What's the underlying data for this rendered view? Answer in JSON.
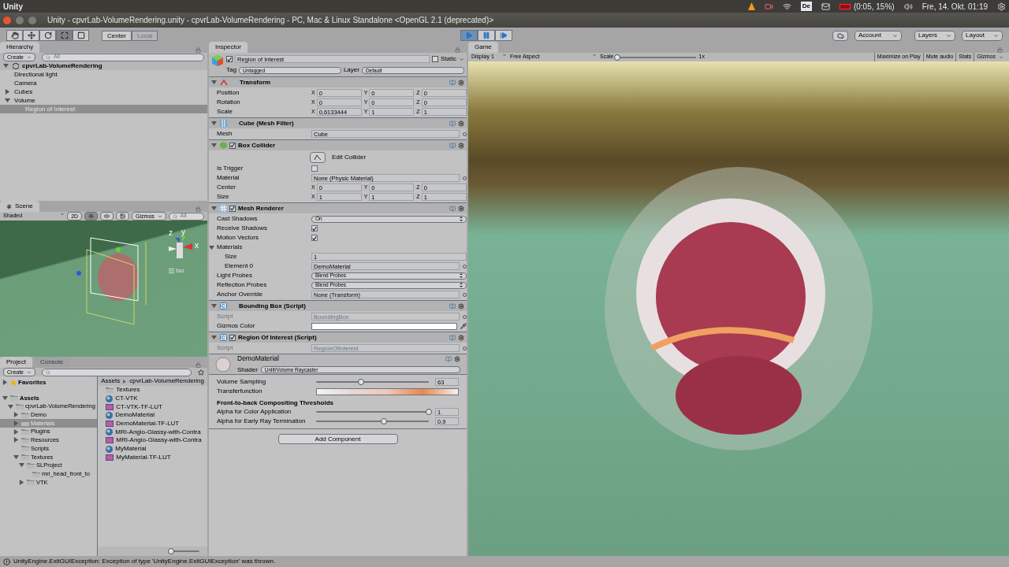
{
  "top_bar": {
    "app": "Unity",
    "keyboard": "De",
    "battery": "(0:05, 15%)",
    "clock": "Fre, 14. Okt. 01:19"
  },
  "window": {
    "title": "Unity - cpvrLab-VolumeRendering.unity - cpvrLab-VolumeRendering - PC, Mac & Linux Standalone <OpenGL 2.1 (deprecated)>"
  },
  "toolbar": {
    "tools": [
      {
        "kind": "hand",
        "selected": false
      },
      {
        "kind": "move",
        "selected": false
      },
      {
        "kind": "rotate",
        "selected": false
      },
      {
        "kind": "scale",
        "selected": true
      },
      {
        "kind": "rect",
        "selected": false
      }
    ],
    "pivot": [
      {
        "label": "Center",
        "selected": true
      },
      {
        "label": "Local",
        "selected": false
      }
    ],
    "playback": [
      {
        "kind": "play",
        "selected": true
      },
      {
        "kind": "pause",
        "selected": false
      },
      {
        "kind": "step",
        "selected": false
      }
    ],
    "account": "Account",
    "layers": "Layers",
    "layout": "Layout"
  },
  "hierarchy": {
    "title": "Hierarchy",
    "create": "Create",
    "search": "All",
    "scene": "cpvrLab-VolumeRendering",
    "items": [
      {
        "label": "Directional light",
        "kind": "leaf",
        "selected": false
      },
      {
        "label": "Camera",
        "kind": "leaf",
        "selected": false
      },
      {
        "label": "Cubes",
        "kind": "group",
        "expanded": false,
        "selected": false
      },
      {
        "label": "Volume",
        "kind": "group",
        "expanded": true,
        "selected": false,
        "children": [
          {
            "label": "Region of Interest",
            "kind": "leaf",
            "selected": true
          }
        ]
      }
    ]
  },
  "scene": {
    "title": "Scene",
    "shading": "Shaded",
    "mode": "2D",
    "gizmos": "Gizmos",
    "search": "All",
    "axes": [
      "z",
      "y",
      "x"
    ],
    "toggles": [
      {
        "kind": "lighting",
        "selected": true
      },
      {
        "kind": "audio",
        "selected": false
      },
      {
        "kind": "effects",
        "selected": false
      }
    ],
    "projection": "Iso"
  },
  "project": {
    "tabs": [
      {
        "label": "Project",
        "selected": true
      },
      {
        "label": "Console",
        "selected": false
      }
    ],
    "create": "Create",
    "favorites": "Favorites",
    "tree": [
      {
        "label": "Assets",
        "expanded": true,
        "selected": false,
        "children": [
          {
            "label": "cpvrLab-VolumeRendering",
            "expanded": true,
            "selected": false,
            "children": [
              {
                "label": "Demo",
                "expanded": false,
                "selected": false
              },
              {
                "label": "Materials",
                "expanded": false,
                "selected": true
              },
              {
                "label": "Plugins",
                "expanded": false,
                "selected": false
              },
              {
                "label": "Resources",
                "expanded": false,
                "selected": false
              },
              {
                "label": "Scripts",
                "selected": false
              },
              {
                "label": "Textures",
                "expanded": true,
                "selected": false,
                "children": [
                  {
                    "label": "SLProject",
                    "expanded": true,
                    "selected": false,
                    "children": [
                      {
                        "label": "mri_head_front_to",
                        "selected": false
                      }
                    ]
                  },
                  {
                    "label": "VTK",
                    "expanded": false,
                    "selected": false
                  }
                ]
              }
            ]
          }
        ]
      }
    ],
    "breadcrumb": [
      "Assets",
      "cpvrLab-VolumeRendering"
    ],
    "files": [
      {
        "label": "Textures",
        "kind": "folder"
      },
      {
        "label": "CT-VTK",
        "kind": "material"
      },
      {
        "label": "CT-VTK-TF-LUT",
        "kind": "texture"
      },
      {
        "label": "DemoMaterial",
        "kind": "material"
      },
      {
        "label": "DemoMaterial-TF-LUT",
        "kind": "texture"
      },
      {
        "label": "MRI-Angio-Glassy-with-Contra",
        "kind": "material"
      },
      {
        "label": "MRI-Angio-Glassy-with-Contra",
        "kind": "texture"
      },
      {
        "label": "MyMaterial",
        "kind": "material"
      },
      {
        "label": "MyMaterial-TF-LUT",
        "kind": "texture"
      }
    ]
  },
  "inspector": {
    "title": "Inspector",
    "name": "Region of Interest",
    "active": true,
    "static_label": "Static",
    "static": false,
    "tag_label": "Tag",
    "tag": "Untagged",
    "layer_label": "Layer",
    "layer": "Default",
    "components": [
      {
        "title": "Transform",
        "kind": "transform",
        "rows": [
          {
            "kind": "vector",
            "label": "Position",
            "values": [
              {
                "axis": "X",
                "value": "0"
              },
              {
                "axis": "Y",
                "value": "0"
              },
              {
                "axis": "Z",
                "value": "0"
              }
            ]
          },
          {
            "kind": "vector",
            "label": "Rotation",
            "values": [
              {
                "axis": "X",
                "value": "0"
              },
              {
                "axis": "Y",
                "value": "0"
              },
              {
                "axis": "Z",
                "value": "0"
              }
            ]
          },
          {
            "kind": "vector",
            "label": "Scale",
            "values": [
              {
                "axis": "X",
                "value": "0,6133444"
              },
              {
                "axis": "Y",
                "value": "1"
              },
              {
                "axis": "Z",
                "value": "1"
              }
            ]
          }
        ]
      },
      {
        "title": "Cube (Mesh Filter)",
        "kind": "mesh",
        "rows": [
          {
            "kind": "object",
            "label": "Mesh",
            "value": "Cube",
            "disabled": false
          }
        ]
      },
      {
        "title": "Box Collider",
        "kind": "collider",
        "enabled": true,
        "rows": [
          {
            "kind": "button",
            "label": "Edit Collider"
          },
          {
            "kind": "checkbox",
            "label": "Is Trigger",
            "checked": false
          },
          {
            "kind": "object",
            "label": "Material",
            "value": "None (Physic Material)",
            "disabled": false
          },
          {
            "kind": "vector",
            "label": "Center",
            "values": [
              {
                "axis": "X",
                "value": "0"
              },
              {
                "axis": "Y",
                "value": "0"
              },
              {
                "axis": "Z",
                "value": "0"
              }
            ]
          },
          {
            "kind": "vector",
            "label": "Size",
            "values": [
              {
                "axis": "X",
                "value": "1"
              },
              {
                "axis": "Y",
                "value": "1"
              },
              {
                "axis": "Z",
                "value": "1"
              }
            ]
          }
        ]
      },
      {
        "title": "Mesh Renderer",
        "kind": "renderer",
        "enabled": true,
        "rows": [
          {
            "kind": "popup",
            "label": "Cast Shadows",
            "value": "On"
          },
          {
            "kind": "checkbox",
            "label": "Receive Shadows",
            "checked": true
          },
          {
            "kind": "checkbox",
            "label": "Motion Vectors",
            "checked": true
          },
          {
            "kind": "heading",
            "label": "Materials",
            "expanded": true
          },
          {
            "kind": "text",
            "label": "Size",
            "value": "1",
            "indent": true
          },
          {
            "kind": "object",
            "label": "Element 0",
            "value": "DemoMaterial",
            "disabled": false,
            "indent": true
          },
          {
            "kind": "popup",
            "label": "Light Probes",
            "value": "Blend Probes"
          },
          {
            "kind": "popup",
            "label": "Reflection Probes",
            "value": "Blend Probes"
          },
          {
            "kind": "object",
            "label": "Anchor Override",
            "value": "None (Transform)",
            "disabled": false
          }
        ]
      },
      {
        "title": "Bounding Box (Script)",
        "kind": "script",
        "rows": [
          {
            "kind": "object",
            "label": "Script",
            "value": "BoundingBox",
            "disabled": true
          },
          {
            "kind": "color",
            "label": "Gizmos Color",
            "color": "#ffffff"
          }
        ]
      },
      {
        "title": "Region Of Interest (Script)",
        "kind": "script",
        "enabled": true,
        "rows": [
          {
            "kind": "object",
            "label": "Script",
            "value": "RegionOfInterest",
            "disabled": true
          }
        ]
      }
    ],
    "material": {
      "name": "DemoMaterial",
      "shader_label": "Shader",
      "shader": "Unlit/Volume Raycaster",
      "props": [
        {
          "kind": "slider",
          "label": "Volume Sampling",
          "level": 0.4,
          "value": "63"
        },
        {
          "kind": "gradient",
          "label": "Transferfunction"
        },
        {
          "kind": "heading",
          "label": "Front-to-back Compositing Thresholds"
        },
        {
          "kind": "slider",
          "label": "Alpha for Color Application",
          "level": 1,
          "value": "1"
        },
        {
          "kind": "slider",
          "label": "Alpha for Early Ray Termination",
          "level": 0.6,
          "value": "0,9"
        }
      ]
    },
    "add_component": "Add Component"
  },
  "game": {
    "title": "Game",
    "display": "Display 1",
    "aspect": "Free Aspect",
    "scale_label": "Scale",
    "scale_slider": {
      "level": 0
    },
    "scale_value": "1x",
    "toggles": [
      {
        "label": "Maximize on Play",
        "selected": false
      },
      {
        "label": "Mute audio",
        "selected": false
      },
      {
        "label": "Stats",
        "selected": false
      }
    ],
    "gizmos": "Gizmos"
  },
  "status_bar": {
    "message": "UnityEngine.ExitGUIException: Exception of type 'UnityEngine.ExitGUIException' was thrown."
  }
}
